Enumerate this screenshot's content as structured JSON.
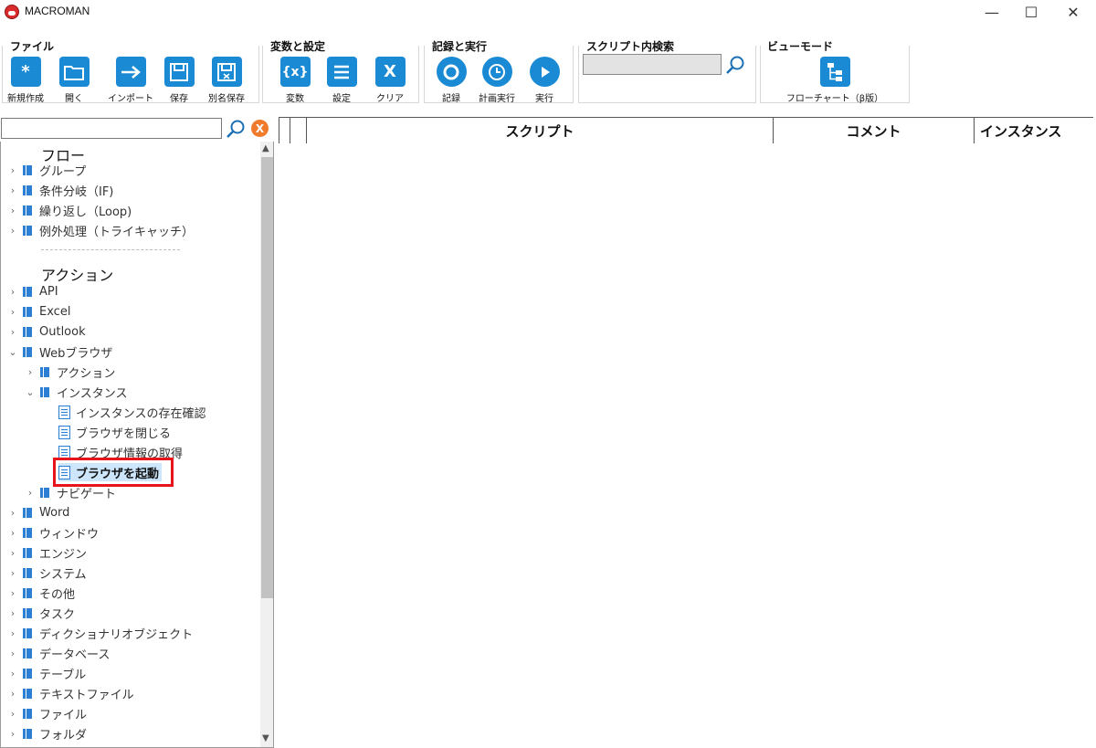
{
  "app": {
    "title": "MACROMAN"
  },
  "window": {
    "minimize": "—",
    "maximize": "☐",
    "close": "✕"
  },
  "ribbon": {
    "groups": [
      {
        "label": "ファイル",
        "tools": [
          "新規作成",
          "開く",
          "インポート",
          "保存",
          "別名保存"
        ]
      },
      {
        "label": "変数と設定",
        "tools": [
          "変数",
          "設定",
          "クリア"
        ]
      },
      {
        "label": "記録と実行",
        "tools": [
          "記録",
          "計画実行",
          "実行"
        ]
      },
      {
        "label": "スクリプト内検索",
        "search_value": ""
      },
      {
        "label": "ビューモード",
        "tools": [
          "フローチャート（β版）"
        ]
      }
    ],
    "icons": {
      "new": "*",
      "variables": "{x}",
      "clear": "X"
    }
  },
  "left": {
    "search_value": "",
    "clear_icon": "X",
    "flow_header": "フロー",
    "flow_items": [
      "グループ",
      "条件分岐（IF)",
      "繰り返し（Loop)",
      "例外処理（トライキャッチ）"
    ],
    "action_header": "アクション",
    "action_items": [
      "API",
      "Excel",
      "Outlook",
      "Webブラウザ"
    ],
    "web_children": [
      "アクション",
      "インスタンス"
    ],
    "instance_children": [
      "インスタンスの存在確認",
      "ブラウザを閉じる",
      "ブラウザ情報の取得",
      "ブラウザを起動"
    ],
    "navigate": "ナビゲート",
    "rest_items": [
      "Word",
      "ウィンドウ",
      "エンジン",
      "システム",
      "その他",
      "タスク",
      "ディクショナリオブジェクト",
      "データベース",
      "テーブル",
      "テキストファイル",
      "ファイル",
      "フォルダ"
    ]
  },
  "grid": {
    "columns": [
      "",
      "",
      "スクリプト",
      "コメント",
      "インスタンス"
    ]
  },
  "colors": {
    "accent": "#1a8ad4",
    "highlight": "#e8141b",
    "clear": "#f07b2d"
  }
}
